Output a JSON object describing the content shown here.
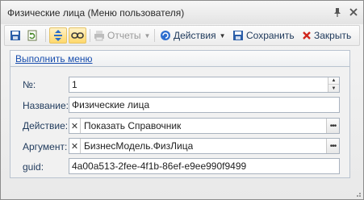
{
  "window": {
    "title": "Физические лица (Меню пользователя)"
  },
  "titlebar_icons": {
    "pin": "pin-icon",
    "close": "close-icon"
  },
  "toolbar": {
    "reports_label": "Отчеты",
    "actions_label": "Действия",
    "save_label": "Сохранить",
    "close_label": "Закрыть"
  },
  "group": {
    "link": "Выполнить меню"
  },
  "form": {
    "number": {
      "label": "№:",
      "value": "1"
    },
    "name": {
      "label": "Название:",
      "value": "Физические лица"
    },
    "action": {
      "label": "Действие:",
      "value": "Показать Справочник"
    },
    "argument": {
      "label": "Аргумент:",
      "value": "БизнесМодель.ФизЛица"
    },
    "guid": {
      "label": "guid:",
      "value": "4a00a513-2fee-4f1b-86ef-e9ee990f9499"
    }
  },
  "colors": {
    "accent": "#1a4fae",
    "highlight": "#ffd86b",
    "close_red": "#d0261d"
  }
}
